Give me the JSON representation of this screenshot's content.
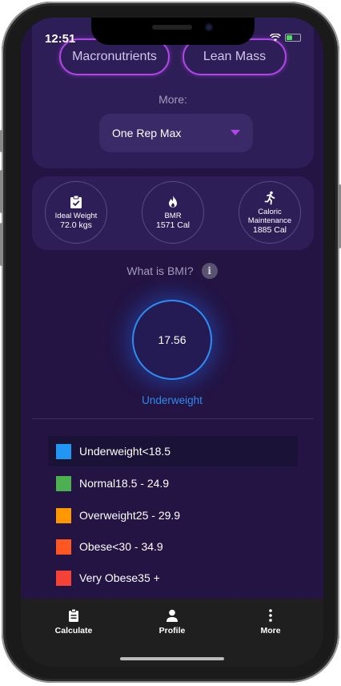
{
  "status": {
    "time": "12:51"
  },
  "top": {
    "buttons": [
      "Macronutrients",
      "Lean Mass"
    ],
    "more_label": "More:",
    "dropdown_value": "One Rep Max"
  },
  "stats": [
    {
      "label": "Ideal Weight",
      "value": "72.0 kgs",
      "icon": "clipboard-check-icon"
    },
    {
      "label": "BMR",
      "value": "1571 Cal",
      "icon": "flame-icon"
    },
    {
      "label": "Caloric Maintenance",
      "label_lines": [
        "Caloric",
        "Maintenance"
      ],
      "value": "1885 Cal",
      "icon": "running-person-icon"
    }
  ],
  "bmi": {
    "question": "What is BMI?",
    "value": "17.56",
    "category": "Underweight",
    "accent": "#2f8cf0"
  },
  "legend": [
    {
      "name": "Underweight",
      "range": "<18.5",
      "color": "#2196f3"
    },
    {
      "name": "Normal",
      "range": "18.5 - 24.9",
      "color": "#4caf50"
    },
    {
      "name": "Overweight",
      "range": "25 - 29.9",
      "color": "#ff9800"
    },
    {
      "name": "Obese",
      "range": "<30 - 34.9",
      "color": "#ff5722"
    },
    {
      "name": "Very Obese",
      "range": "35 +",
      "color": "#f44336"
    }
  ],
  "tabs": [
    {
      "label": "Calculate",
      "icon": "clipboard-icon"
    },
    {
      "label": "Profile",
      "icon": "person-icon"
    },
    {
      "label": "More",
      "icon": "more-vertical-icon"
    }
  ]
}
